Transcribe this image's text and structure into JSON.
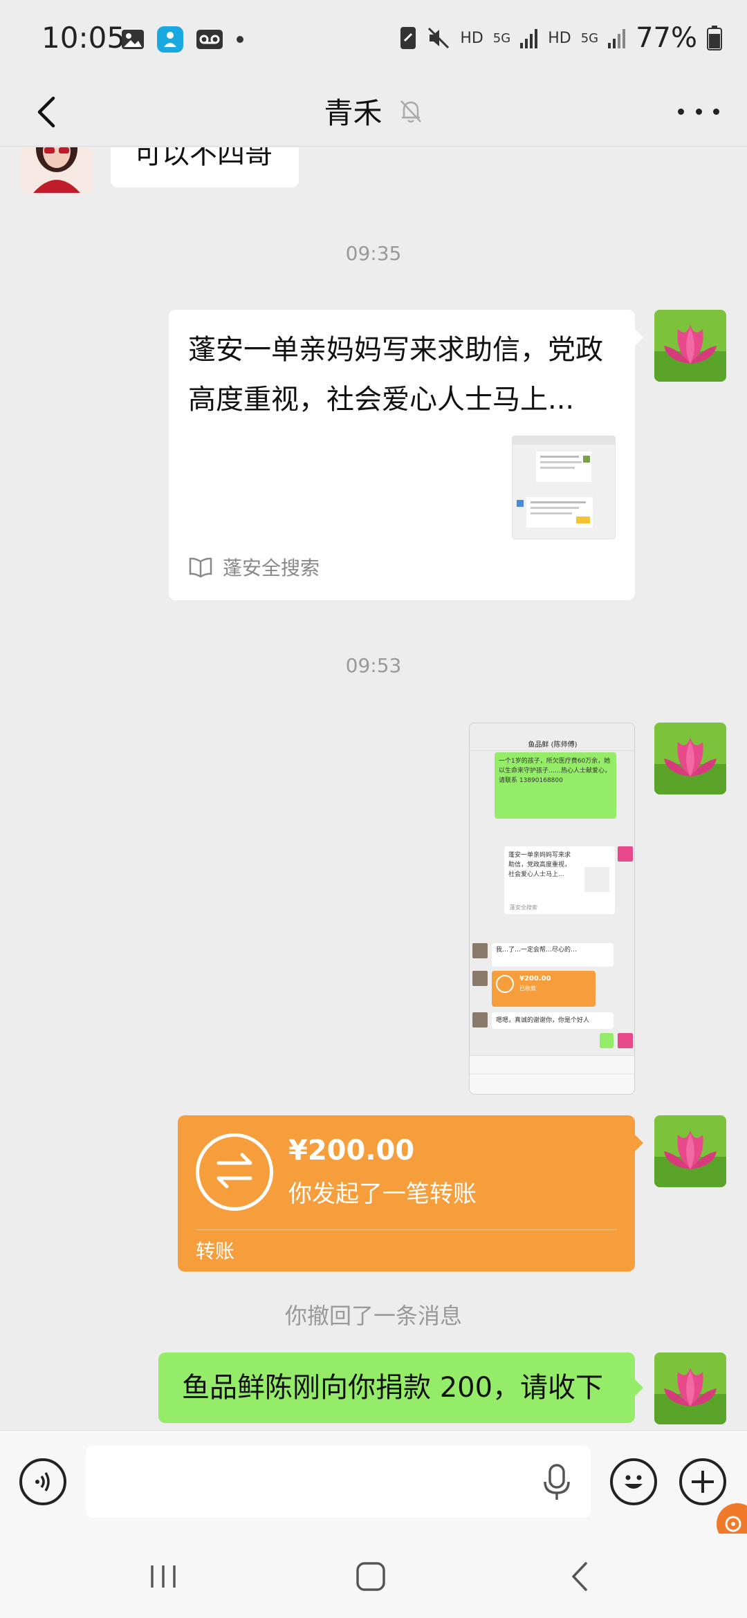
{
  "status_bar": {
    "time": "10:05",
    "network_labels": [
      "HD",
      "5G",
      "HD",
      "5G"
    ],
    "battery": "77%"
  },
  "header": {
    "title": "青禾",
    "icons": [
      "back-arrow-icon",
      "muted-bell-icon",
      "more-dots-icon"
    ]
  },
  "messages": {
    "partial_incoming": "可以不四哥",
    "time_1": "09:35",
    "link_card": {
      "title": "蓬安一单亲妈妈写来求助信，党政高度重视，社会爱心人士马上...",
      "source": "蓬安全搜索"
    },
    "time_2": "09:53",
    "screenshot_mini": {
      "chat_title": "鱼品鲜 (陈师傅)",
      "green_text": "一个1岁的孩子，所欠医疗费60万余，她以生命来守护孩子……热心人士献爱心，请联系 13890168800",
      "card_text": "蓬安一单亲妈妈写来求助信，党政高度重视，社会爱心人士马上...",
      "card_source": "蓬安全搜索",
      "text_1": "我…了…一定会帮…尽心的…",
      "transfer_amount": "¥200.00",
      "transfer_status": "已收款",
      "text_2": "嗯嗯，真诚的谢谢你，你是个好人"
    },
    "transfer": {
      "amount": "¥200.00",
      "description": "你发起了一笔转账",
      "kind": "转账"
    },
    "recall_notice": "你撤回了一条消息",
    "last_outgoing": "鱼品鲜陈刚向你捐款 200，请收下"
  },
  "input_bar": {
    "placeholder": "",
    "icons": [
      "voice-icon",
      "mic-icon",
      "emoji-icon",
      "plus-icon"
    ]
  },
  "colors": {
    "background": "#ededed",
    "outgoing_bubble": "#95ec69",
    "transfer_card": "#f79e3c",
    "incoming_bubble": "#ffffff"
  }
}
